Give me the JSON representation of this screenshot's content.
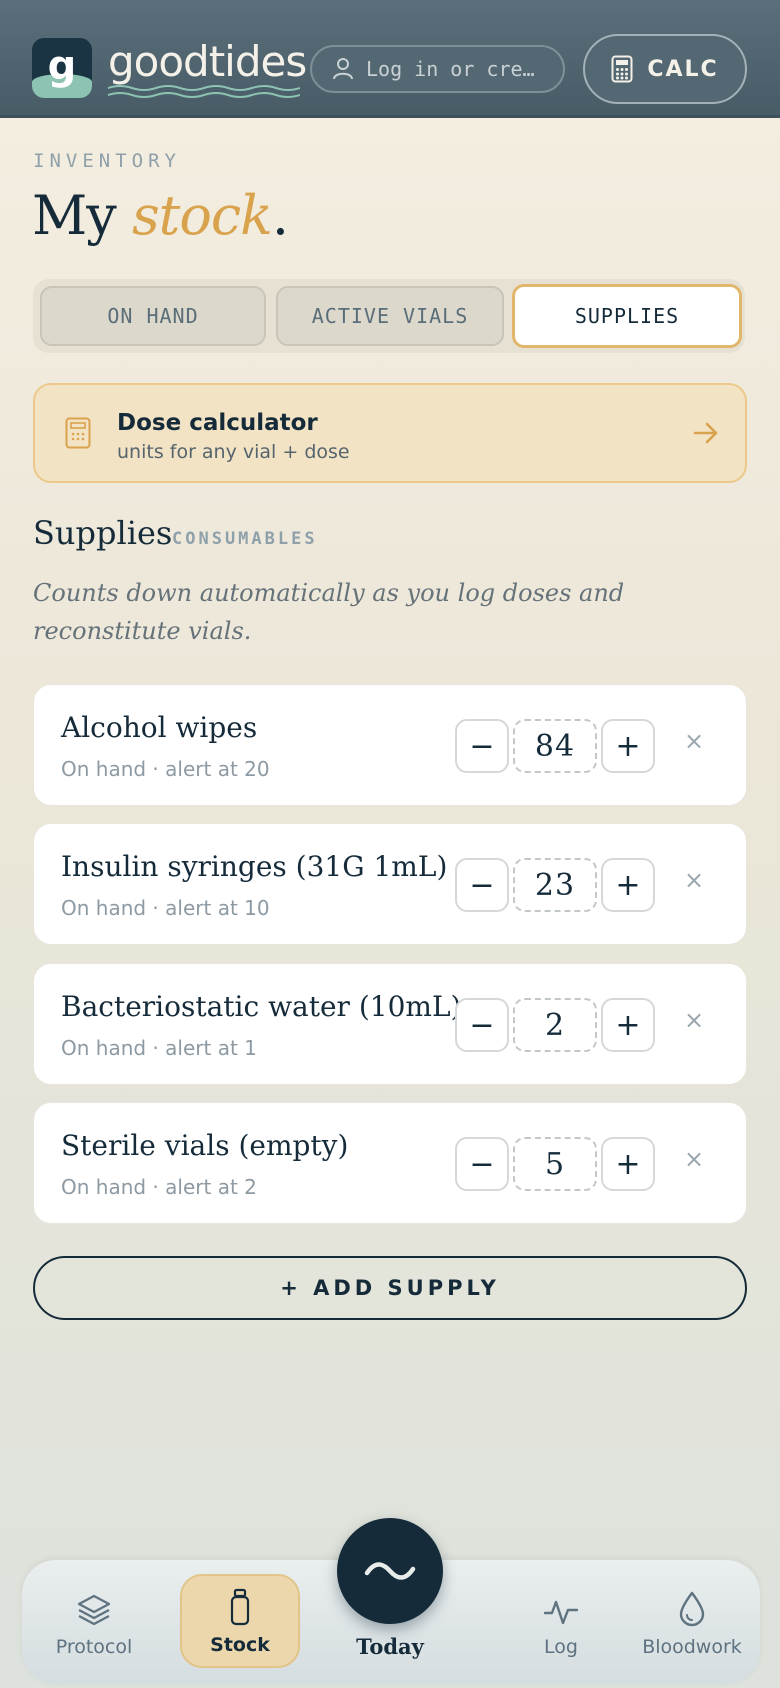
{
  "header": {
    "brand_letter": "g",
    "brand_name": "goodtides",
    "login_placeholder": "Log in or cre…",
    "calc_label": "CALC"
  },
  "page": {
    "eyebrow": "INVENTORY",
    "title_plain": "My ",
    "title_accent": "stock",
    "title_end": "."
  },
  "tabs": [
    {
      "label": "ON HAND",
      "active": false
    },
    {
      "label": "ACTIVE VIALS",
      "active": false
    },
    {
      "label": "SUPPLIES",
      "active": true
    }
  ],
  "dose_card": {
    "title": "Dose calculator",
    "subtitle": "units for any vial + dose"
  },
  "section": {
    "title": "Supplies",
    "tag": "CONSUMABLES",
    "description": "Counts down automatically as you log doses and reconstitute vials."
  },
  "supplies": [
    {
      "name": "Alcohol wipes",
      "meta": "On hand · alert at 20",
      "qty": "84"
    },
    {
      "name": "Insulin syringes (31G 1mL)",
      "meta": "On hand · alert at 10",
      "qty": "23"
    },
    {
      "name": "Bacteriostatic water (10mL)",
      "meta": "On hand · alert at 1",
      "qty": "2"
    },
    {
      "name": "Sterile vials (empty)",
      "meta": "On hand · alert at 2",
      "qty": "5"
    }
  ],
  "controls": {
    "minus": "−",
    "plus": "+",
    "remove": "×"
  },
  "add_supply_label": "+ ADD SUPPLY",
  "nav": {
    "protocol": "Protocol",
    "stock": "Stock",
    "today": "Today",
    "log": "Log",
    "bloodwork": "Bloodwork"
  },
  "colors": {
    "accent": "#d9a24c",
    "navy": "#152b3a",
    "header": "#536873"
  }
}
